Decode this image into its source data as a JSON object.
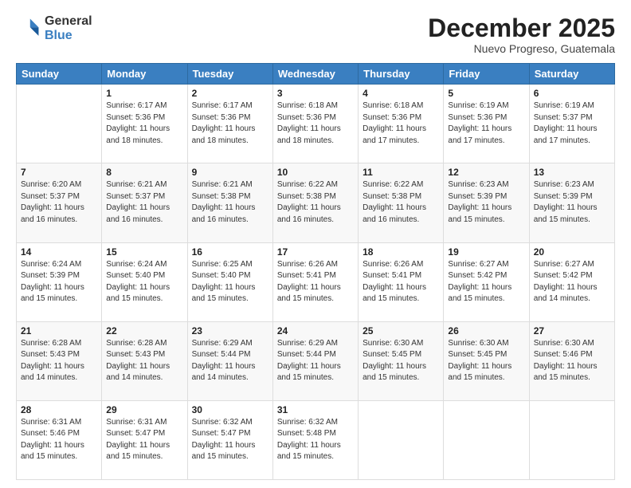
{
  "logo": {
    "general": "General",
    "blue": "Blue"
  },
  "header": {
    "month": "December 2025",
    "location": "Nuevo Progreso, Guatemala"
  },
  "days_of_week": [
    "Sunday",
    "Monday",
    "Tuesday",
    "Wednesday",
    "Thursday",
    "Friday",
    "Saturday"
  ],
  "weeks": [
    [
      {
        "day": "",
        "sunrise": "",
        "sunset": "",
        "daylight": ""
      },
      {
        "day": "1",
        "sunrise": "Sunrise: 6:17 AM",
        "sunset": "Sunset: 5:36 PM",
        "daylight": "Daylight: 11 hours and 18 minutes."
      },
      {
        "day": "2",
        "sunrise": "Sunrise: 6:17 AM",
        "sunset": "Sunset: 5:36 PM",
        "daylight": "Daylight: 11 hours and 18 minutes."
      },
      {
        "day": "3",
        "sunrise": "Sunrise: 6:18 AM",
        "sunset": "Sunset: 5:36 PM",
        "daylight": "Daylight: 11 hours and 18 minutes."
      },
      {
        "day": "4",
        "sunrise": "Sunrise: 6:18 AM",
        "sunset": "Sunset: 5:36 PM",
        "daylight": "Daylight: 11 hours and 17 minutes."
      },
      {
        "day": "5",
        "sunrise": "Sunrise: 6:19 AM",
        "sunset": "Sunset: 5:36 PM",
        "daylight": "Daylight: 11 hours and 17 minutes."
      },
      {
        "day": "6",
        "sunrise": "Sunrise: 6:19 AM",
        "sunset": "Sunset: 5:37 PM",
        "daylight": "Daylight: 11 hours and 17 minutes."
      }
    ],
    [
      {
        "day": "7",
        "sunrise": "Sunrise: 6:20 AM",
        "sunset": "Sunset: 5:37 PM",
        "daylight": "Daylight: 11 hours and 16 minutes."
      },
      {
        "day": "8",
        "sunrise": "Sunrise: 6:21 AM",
        "sunset": "Sunset: 5:37 PM",
        "daylight": "Daylight: 11 hours and 16 minutes."
      },
      {
        "day": "9",
        "sunrise": "Sunrise: 6:21 AM",
        "sunset": "Sunset: 5:38 PM",
        "daylight": "Daylight: 11 hours and 16 minutes."
      },
      {
        "day": "10",
        "sunrise": "Sunrise: 6:22 AM",
        "sunset": "Sunset: 5:38 PM",
        "daylight": "Daylight: 11 hours and 16 minutes."
      },
      {
        "day": "11",
        "sunrise": "Sunrise: 6:22 AM",
        "sunset": "Sunset: 5:38 PM",
        "daylight": "Daylight: 11 hours and 16 minutes."
      },
      {
        "day": "12",
        "sunrise": "Sunrise: 6:23 AM",
        "sunset": "Sunset: 5:39 PM",
        "daylight": "Daylight: 11 hours and 15 minutes."
      },
      {
        "day": "13",
        "sunrise": "Sunrise: 6:23 AM",
        "sunset": "Sunset: 5:39 PM",
        "daylight": "Daylight: 11 hours and 15 minutes."
      }
    ],
    [
      {
        "day": "14",
        "sunrise": "Sunrise: 6:24 AM",
        "sunset": "Sunset: 5:39 PM",
        "daylight": "Daylight: 11 hours and 15 minutes."
      },
      {
        "day": "15",
        "sunrise": "Sunrise: 6:24 AM",
        "sunset": "Sunset: 5:40 PM",
        "daylight": "Daylight: 11 hours and 15 minutes."
      },
      {
        "day": "16",
        "sunrise": "Sunrise: 6:25 AM",
        "sunset": "Sunset: 5:40 PM",
        "daylight": "Daylight: 11 hours and 15 minutes."
      },
      {
        "day": "17",
        "sunrise": "Sunrise: 6:26 AM",
        "sunset": "Sunset: 5:41 PM",
        "daylight": "Daylight: 11 hours and 15 minutes."
      },
      {
        "day": "18",
        "sunrise": "Sunrise: 6:26 AM",
        "sunset": "Sunset: 5:41 PM",
        "daylight": "Daylight: 11 hours and 15 minutes."
      },
      {
        "day": "19",
        "sunrise": "Sunrise: 6:27 AM",
        "sunset": "Sunset: 5:42 PM",
        "daylight": "Daylight: 11 hours and 15 minutes."
      },
      {
        "day": "20",
        "sunrise": "Sunrise: 6:27 AM",
        "sunset": "Sunset: 5:42 PM",
        "daylight": "Daylight: 11 hours and 14 minutes."
      }
    ],
    [
      {
        "day": "21",
        "sunrise": "Sunrise: 6:28 AM",
        "sunset": "Sunset: 5:43 PM",
        "daylight": "Daylight: 11 hours and 14 minutes."
      },
      {
        "day": "22",
        "sunrise": "Sunrise: 6:28 AM",
        "sunset": "Sunset: 5:43 PM",
        "daylight": "Daylight: 11 hours and 14 minutes."
      },
      {
        "day": "23",
        "sunrise": "Sunrise: 6:29 AM",
        "sunset": "Sunset: 5:44 PM",
        "daylight": "Daylight: 11 hours and 14 minutes."
      },
      {
        "day": "24",
        "sunrise": "Sunrise: 6:29 AM",
        "sunset": "Sunset: 5:44 PM",
        "daylight": "Daylight: 11 hours and 15 minutes."
      },
      {
        "day": "25",
        "sunrise": "Sunrise: 6:30 AM",
        "sunset": "Sunset: 5:45 PM",
        "daylight": "Daylight: 11 hours and 15 minutes."
      },
      {
        "day": "26",
        "sunrise": "Sunrise: 6:30 AM",
        "sunset": "Sunset: 5:45 PM",
        "daylight": "Daylight: 11 hours and 15 minutes."
      },
      {
        "day": "27",
        "sunrise": "Sunrise: 6:30 AM",
        "sunset": "Sunset: 5:46 PM",
        "daylight": "Daylight: 11 hours and 15 minutes."
      }
    ],
    [
      {
        "day": "28",
        "sunrise": "Sunrise: 6:31 AM",
        "sunset": "Sunset: 5:46 PM",
        "daylight": "Daylight: 11 hours and 15 minutes."
      },
      {
        "day": "29",
        "sunrise": "Sunrise: 6:31 AM",
        "sunset": "Sunset: 5:47 PM",
        "daylight": "Daylight: 11 hours and 15 minutes."
      },
      {
        "day": "30",
        "sunrise": "Sunrise: 6:32 AM",
        "sunset": "Sunset: 5:47 PM",
        "daylight": "Daylight: 11 hours and 15 minutes."
      },
      {
        "day": "31",
        "sunrise": "Sunrise: 6:32 AM",
        "sunset": "Sunset: 5:48 PM",
        "daylight": "Daylight: 11 hours and 15 minutes."
      },
      {
        "day": "",
        "sunrise": "",
        "sunset": "",
        "daylight": ""
      },
      {
        "day": "",
        "sunrise": "",
        "sunset": "",
        "daylight": ""
      },
      {
        "day": "",
        "sunrise": "",
        "sunset": "",
        "daylight": ""
      }
    ]
  ]
}
